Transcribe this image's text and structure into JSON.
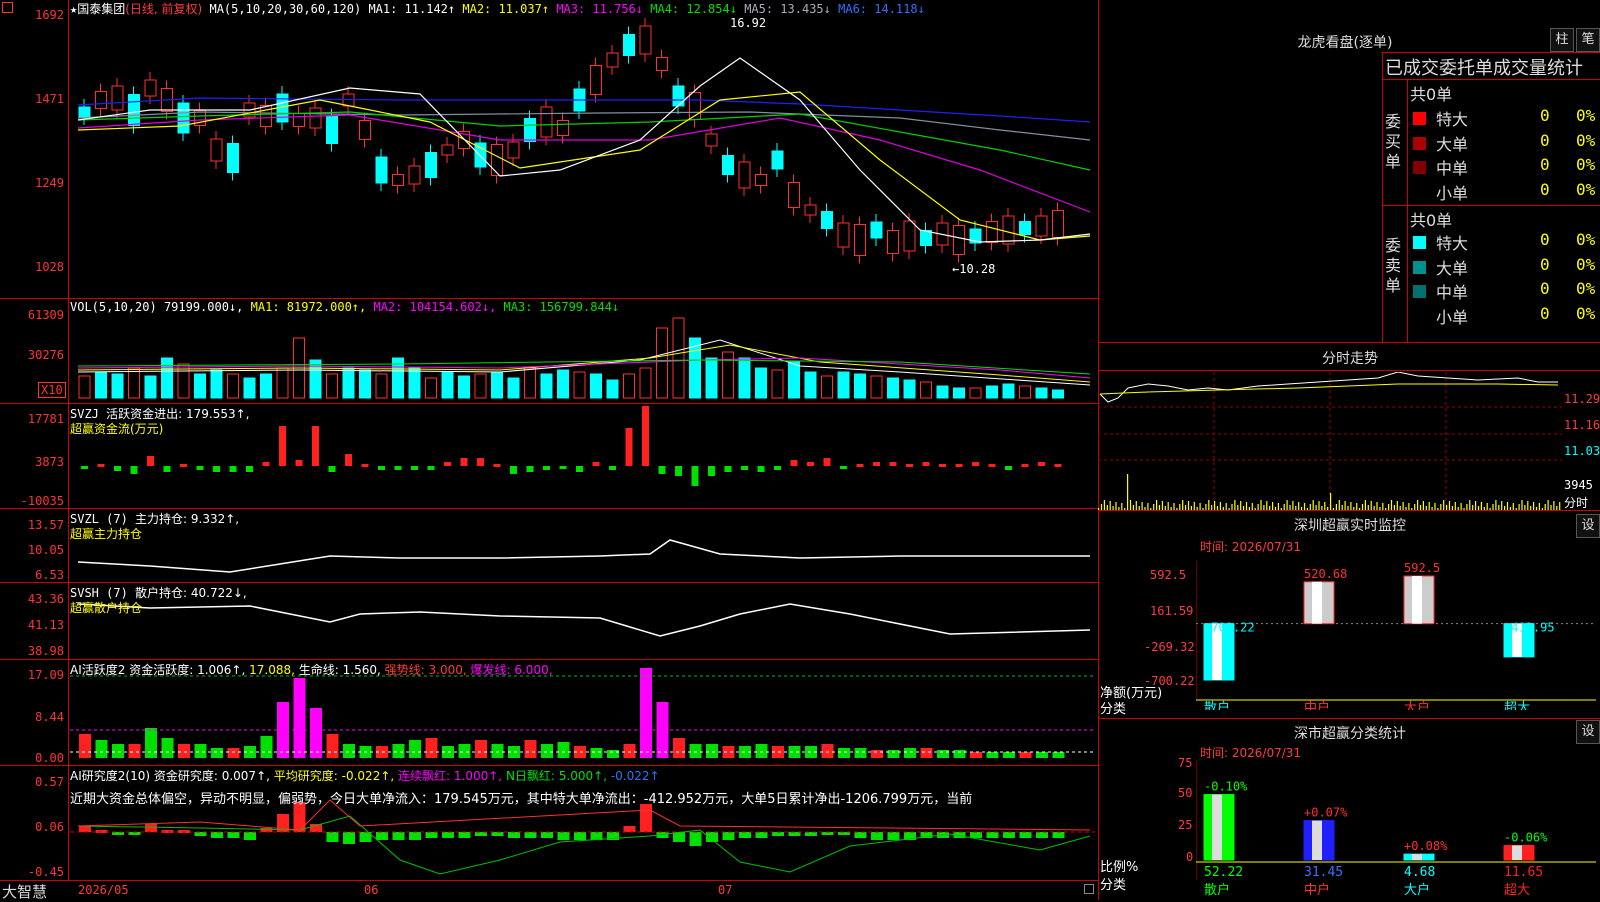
{
  "stock": {
    "name": "国泰集团",
    "mode": "(日线, 前复权)",
    "star": "★"
  },
  "price_pane": {
    "ma_header": "MA(5,10,20,30,60,120)",
    "ma1": "MA1: 11.142↑",
    "ma2": "MA2: 11.037↑",
    "ma3": "MA3: 11.756↓",
    "ma4": "MA4: 12.854↓",
    "ma5": "MA5: 13.435↓",
    "ma6": "MA6: 14.118↓",
    "y_labels": [
      "1692",
      "1471",
      "1249",
      "1028"
    ],
    "high_mark": "16.92",
    "low_mark": "←10.28",
    "colors": {
      "ma1": "#ffffff",
      "ma2": "#ffff00",
      "ma3": "#ff00ff",
      "ma4": "#00ff00",
      "ma5": "#6080a0",
      "ma6": "#2020ff"
    }
  },
  "vol_pane": {
    "header": "VOL(5,10,20)",
    "value": "79199.000↓,",
    "ma1": "MA1: 81972.000↑,",
    "ma2": "MA2: 104154.602↓,",
    "ma3": "MA3: 156799.844↓",
    "y_labels": [
      "61309",
      "30276"
    ],
    "unit": "X10"
  },
  "svzj_pane": {
    "header": "SVZJ",
    "label": "活跃资金进出: 179.553↑,",
    "sub": "超赢资金流(万元)",
    "y_labels": [
      "17781",
      "3873",
      "-10035"
    ]
  },
  "svzl_pane": {
    "header": "SVZL (7)",
    "label": "主力持仓: 9.332↑,",
    "sub": "超赢主力持仓",
    "y_labels": [
      "13.57",
      "10.05",
      "6.53"
    ]
  },
  "svsh_pane": {
    "header": "SVSH (7)",
    "label": "散户持仓: 40.722↓,",
    "sub": "超赢散户持仓",
    "y_labels": [
      "43.36",
      "41.13",
      "38.98"
    ]
  },
  "ai_active_pane": {
    "header": "AI活跃度2",
    "label1": "资金活跃度: 1.006↑,",
    "label2": "17.088,",
    "label3": "生命线: 1.560,",
    "label4": "强势线: 3.000,",
    "label5": "爆发线: 6.000,",
    "y_labels": [
      "17.09",
      "8.44",
      "0.00"
    ]
  },
  "ai_research_pane": {
    "header": "AI研究度2(10)",
    "label1": "资金研究度: 0.007↑,",
    "label2": "平均研究度: -0.022↑,",
    "label3": "连续飘红: 1.000↑,",
    "label4": "N日飘红: 5.000↑,",
    "label5": "-0.022↑",
    "comment": "近期大资金总体偏空，异动不明显，偏弱势，今日大单净流入：179.545万元，其中特大单净流出：-412.952万元，大单5日累计净出-1206.799万元，当前",
    "y_labels": [
      "0.57",
      "0.06",
      "-0.45"
    ]
  },
  "x_axis": {
    "brand": "大智慧",
    "labels": [
      "2026/05",
      "06",
      "07"
    ]
  },
  "right_panel": {
    "lhb_title": "龙虎看盘(逐单)",
    "btn_zhu": "柱",
    "btn_bi": "笔",
    "trade_title": "已成交委托单成交量统计",
    "buy_side": "委买单",
    "sell_side": "委卖单",
    "buy_total": "共0单",
    "sell_total": "共0单",
    "buy_rows": [
      {
        "label": "特大",
        "count": "0",
        "pct": "0%",
        "color": "#ff0000"
      },
      {
        "label": "大单",
        "count": "0",
        "pct": "0%",
        "color": "#aa0000"
      },
      {
        "label": "中单",
        "count": "0",
        "pct": "0%",
        "color": "#800000"
      },
      {
        "label": "小单",
        "count": "0",
        "pct": "0%",
        "color": "#000000"
      }
    ],
    "sell_rows": [
      {
        "label": "特大",
        "count": "0",
        "pct": "0%",
        "color": "#00ffff"
      },
      {
        "label": "大单",
        "count": "0",
        "pct": "0%",
        "color": "#009090"
      },
      {
        "label": "中单",
        "count": "0",
        "pct": "0%",
        "color": "#007070"
      },
      {
        "label": "小单",
        "count": "0",
        "pct": "0%",
        "color": "#000000"
      }
    ],
    "intraday_title": "分时走势",
    "intraday_y": [
      "11.29",
      "11.16",
      "11.03"
    ],
    "intraday_vol": "3945",
    "intraday_unit": "分时",
    "sz_monitor_title": "深圳超赢实时监控",
    "sz_time": "时间: 2026/07/31",
    "sz_y": [
      "592.5",
      "161.59",
      "-269.32",
      "-700.22"
    ],
    "sz_axis_label1": "净额(万元)",
    "sz_axis_label2": "分类",
    "sz_bars": [
      {
        "cat": "散户",
        "value": -700.22,
        "label": "-700.22"
      },
      {
        "cat": "中户",
        "value": 520.68,
        "label": "520.68"
      },
      {
        "cat": "大户",
        "value": 592.5,
        "label": "592.5"
      },
      {
        "cat": "超大",
        "value": -412.95,
        "label": "-412.95"
      }
    ],
    "sz_class_title": "深市超赢分类统计",
    "sz_class_time": "时间: 2026/07/31",
    "class_y": [
      "75",
      "50",
      "25",
      "0"
    ],
    "class_axis_label1": "比例%",
    "class_axis_label2": "分类",
    "class_bars": [
      {
        "cat": "散户",
        "value": 52.22,
        "label": "52.22",
        "change": "-0.10%"
      },
      {
        "cat": "中户",
        "value": 31.45,
        "label": "31.45",
        "change": "+0.07%"
      },
      {
        "cat": "大户",
        "value": 4.68,
        "label": "4.68",
        "change": "+0.08%"
      },
      {
        "cat": "超大",
        "value": 11.65,
        "label": "11.65",
        "change": "-0.06%"
      }
    ],
    "btn_set": "设"
  }
}
